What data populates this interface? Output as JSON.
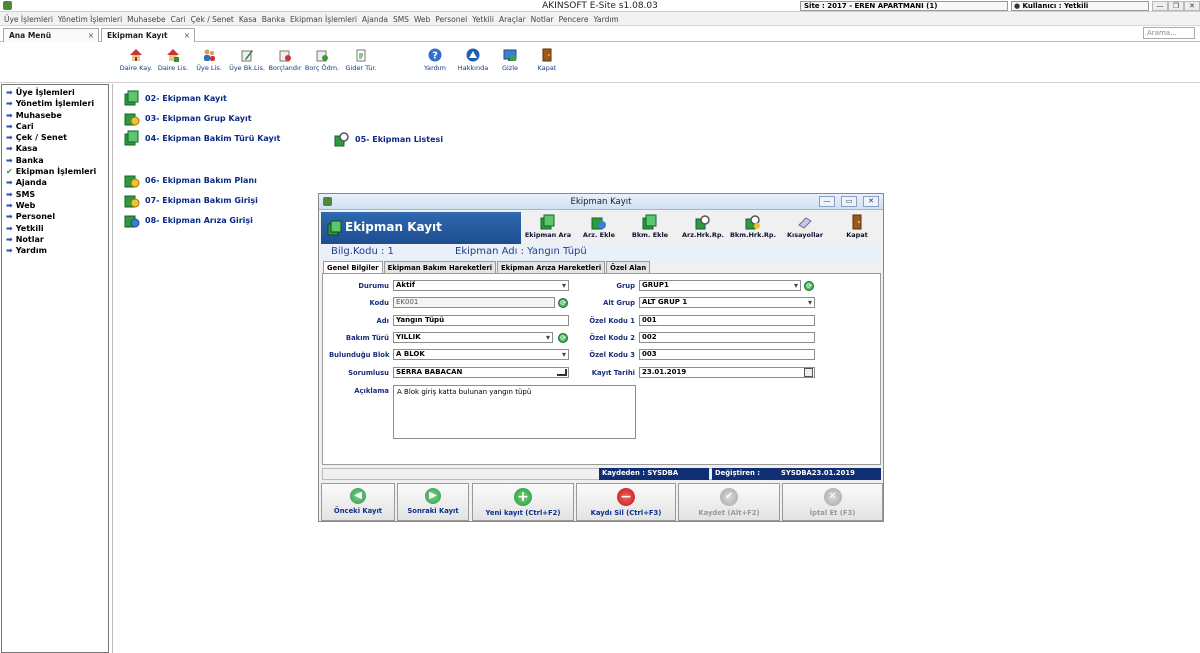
{
  "app": {
    "title": "AKINSOFT E-Site s1.08.03",
    "site_info": "Site : 2017 - EREN APARTMANI (1)",
    "user_info": "Kullanıcı : Yetkili",
    "search_placeholder": "Arama..."
  },
  "menu": [
    "Üye İşlemleri",
    "Yönetim İşlemleri",
    "Muhasebe",
    "Cari",
    "Çek / Senet",
    "Kasa",
    "Banka",
    "Ekipman İşlemleri",
    "Ajanda",
    "SMS",
    "Web",
    "Personel",
    "Yetkili",
    "Araçlar",
    "Notlar",
    "Pencere",
    "Yardım"
  ],
  "tabs": [
    {
      "label": "Ana Menü",
      "close": "×"
    },
    {
      "label": "Ekipman Kayıt",
      "close": "×"
    }
  ],
  "toolbar": [
    "Daire Kay.",
    "Daire Lis.",
    "Üye Lis.",
    "Üye Bk.Lis.",
    "Borçlandır",
    "Borç Ödm.",
    "Gider Tür.",
    "Yardım",
    "Hakkında",
    "Gizle",
    "Kapat"
  ],
  "sidebar": [
    "Üye İşlemleri",
    "Yönetim İşlemleri",
    "Muhasebe",
    "Cari",
    "Çek / Senet",
    "Kasa",
    "Banka",
    "Ekipman İşlemleri",
    "Ajanda",
    "SMS",
    "Web",
    "Personel",
    "Yetkili",
    "Notlar",
    "Yardım"
  ],
  "links": {
    "l02": "02- Ekipman Kayıt",
    "l03": "03- Ekipman Grup Kayıt",
    "l04": "04- Ekipman Bakim Türü Kayıt",
    "l05": "05- Ekipman Listesi",
    "l06": "06- Ekipman Bakım Planı",
    "l07": "07- Ekipman Bakım Girişi",
    "l08": "08- Ekipman Arıza Girişi"
  },
  "dialog": {
    "title": "Ekipman Kayıt",
    "header": "Ekipman Kayıt",
    "tools": [
      "Ekipman Ara",
      "Arz. Ekle",
      "Bkm. Ekle",
      "Arz.Hrk.Rp.",
      "Bkm.Hrk.Rp.",
      "Kısayollar",
      "Kapat"
    ],
    "bilg_kodu": "Bilg.Kodu : 1",
    "ekipman_adi": "Ekipman Adı : Yangın Tüpü",
    "tabs": [
      "Genel Bilgiler",
      "Ekipman Bakım Hareketleri",
      "Ekipman Arıza Hareketleri",
      "Özel Alan"
    ],
    "form": {
      "durumu_label": "Durumu",
      "durumu": "Aktif",
      "kodu_label": "Kodu",
      "kodu": "EK001",
      "adi_label": "Adı",
      "adi": "Yangın Tüpü",
      "bakim_turu_label": "Bakım Türü",
      "bakim_turu": "YILLIK",
      "blok_label": "Bulunduğu Blok",
      "blok": "A BLOK",
      "sorumlusu_label": "Sorumlusu",
      "sorumlusu": "SERRA BABACAN",
      "aciklama_label": "Açıklama",
      "aciklama": "A Blok giriş katta bulunan yangın tüpü",
      "grup_label": "Grup",
      "grup": "GRUP1",
      "alt_grup_label": "Alt Grup",
      "alt_grup": "ALT GRUP 1",
      "ozel1_label": "Özel Kodu 1",
      "ozel1": "001",
      "ozel2_label": "Özel Kodu 2",
      "ozel2": "002",
      "ozel3_label": "Özel Kodu 3",
      "ozel3": "003",
      "kayit_tarihi_label": "Kayıt Tarihi",
      "kayit_tarihi": "23.01.2019"
    },
    "status": {
      "kaydeden": "Kaydeden : SYSDBA",
      "degistiren": "Değiştiren :",
      "degistiren_val": "SYSDBA23.01.2019"
    },
    "buttons": [
      "Önceki Kayıt",
      "Sonraki Kayıt",
      "Yeni kayıt (Ctrl+F2)",
      "Kaydı Sil (Ctrl+F3)",
      "Kaydet (Alt+F2)",
      "İptal Et (F3)"
    ]
  }
}
